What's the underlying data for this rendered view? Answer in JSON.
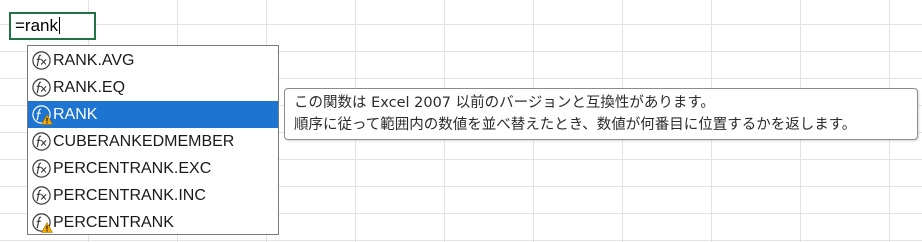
{
  "cell": {
    "formula_text": "=rank"
  },
  "autocomplete": {
    "items": [
      {
        "label": "RANK.AVG",
        "icon": "function-icon",
        "warning": false
      },
      {
        "label": "RANK.EQ",
        "icon": "function-icon",
        "warning": false
      },
      {
        "label": "RANK",
        "icon": "function-compat-warning-icon",
        "warning": true
      },
      {
        "label": "CUBERANKEDMEMBER",
        "icon": "function-icon",
        "warning": false
      },
      {
        "label": "PERCENTRANK.EXC",
        "icon": "function-icon",
        "warning": false
      },
      {
        "label": "PERCENTRANK.INC",
        "icon": "function-icon",
        "warning": false
      },
      {
        "label": "PERCENTRANK",
        "icon": "function-compat-warning-icon",
        "warning": true
      }
    ],
    "selected_label": "RANK"
  },
  "tooltip": {
    "line1": "この関数は Excel 2007 以前のバージョンと互換性があります。",
    "line2": "順序に従って範囲内の数値を並べ替えたとき、数値が何番目に位置するかを返します。"
  },
  "colors": {
    "selection": "#1d74d1",
    "cell_border": "#217346",
    "gridline": "#e3e3e3",
    "warning": "#f2a900"
  }
}
